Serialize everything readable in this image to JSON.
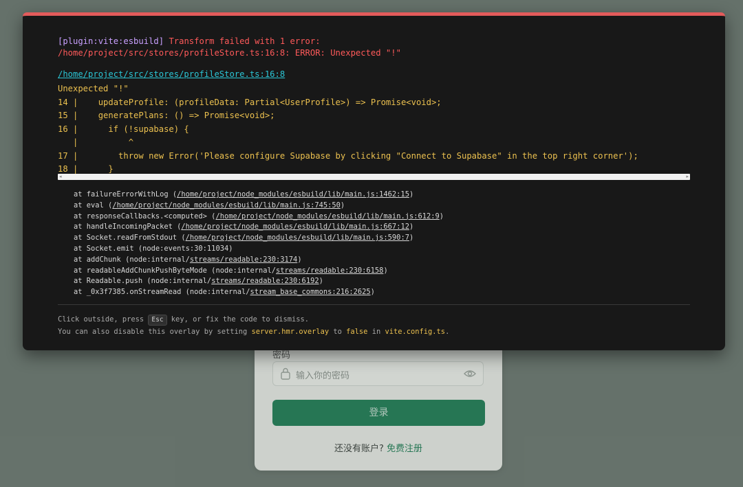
{
  "login": {
    "password_label": "密码",
    "password_placeholder": "输入你的密码",
    "login_button": "登录",
    "signup_prompt": "还没有账户?",
    "signup_link": "免费注册"
  },
  "overlay": {
    "plugin": "[plugin:vite:esbuild]",
    "title": "Transform failed with 1 error:",
    "error_line": "/home/project/src/stores/profileStore.ts:16:8: ERROR: Unexpected \"!\"",
    "file_link": "/home/project/src/stores/profileStore.ts:16:8",
    "message": "Unexpected \"!\"",
    "code_frame": [
      "14 |    updateProfile: (profileData: Partial<UserProfile>) => Promise<void>;",
      "15 |    generatePlans: () => Promise<void>;",
      "16 |      if (!supabase) {",
      "   |          ^",
      "17 |        throw new Error('Please configure Supabase by clicking \"Connect to Supabase\" in the top right corner');",
      "18 |      }"
    ],
    "stack": [
      {
        "prefix": "at failureErrorWithLog (",
        "link": "/home/project/node_modules/esbuild/lib/main.js:1462:15",
        "suffix": ")"
      },
      {
        "prefix": "at eval (",
        "link": "/home/project/node_modules/esbuild/lib/main.js:745:50",
        "suffix": ")"
      },
      {
        "prefix": "at responseCallbacks.<computed> (",
        "link": "/home/project/node_modules/esbuild/lib/main.js:612:9",
        "suffix": ")"
      },
      {
        "prefix": "at handleIncomingPacket (",
        "link": "/home/project/node_modules/esbuild/lib/main.js:667:12",
        "suffix": ")"
      },
      {
        "prefix": "at Socket.readFromStdout (",
        "link": "/home/project/node_modules/esbuild/lib/main.js:590:7",
        "suffix": ")"
      },
      {
        "prefix": "at Socket.emit (node:events:30:11034)",
        "link": "",
        "suffix": ""
      },
      {
        "prefix": "at addChunk (node:internal/",
        "link": "streams/readable:230:3174",
        "suffix": ")"
      },
      {
        "prefix": "at readableAddChunkPushByteMode (node:internal/",
        "link": "streams/readable:230:6158",
        "suffix": ")"
      },
      {
        "prefix": "at Readable.push (node:internal/",
        "link": "streams/readable:230:6192",
        "suffix": ")"
      },
      {
        "prefix": "at _0x3f7385.onStreamRead (node:internal/",
        "link": "stream_base_commons:216:2625",
        "suffix": ")"
      }
    ],
    "tip": {
      "line1_a": "Click outside, press ",
      "esc": "Esc",
      "line1_b": " key, or fix the code to dismiss.",
      "line2_a": "You can also disable this overlay by setting ",
      "setting": "server.hmr.overlay",
      "line2_b": " to ",
      "false_kw": "false",
      "line2_c": " in ",
      "config": "vite.config.ts",
      "line2_d": "."
    }
  },
  "colors": {
    "overlay_border": "#e35b5b",
    "plugin": "#c9a0ff",
    "error": "#ff5a5a",
    "link": "#2bc6d6",
    "frame": "#ebc04f",
    "primary": "#1e7c55"
  },
  "icons": [
    "lock-icon",
    "eye-icon"
  ]
}
